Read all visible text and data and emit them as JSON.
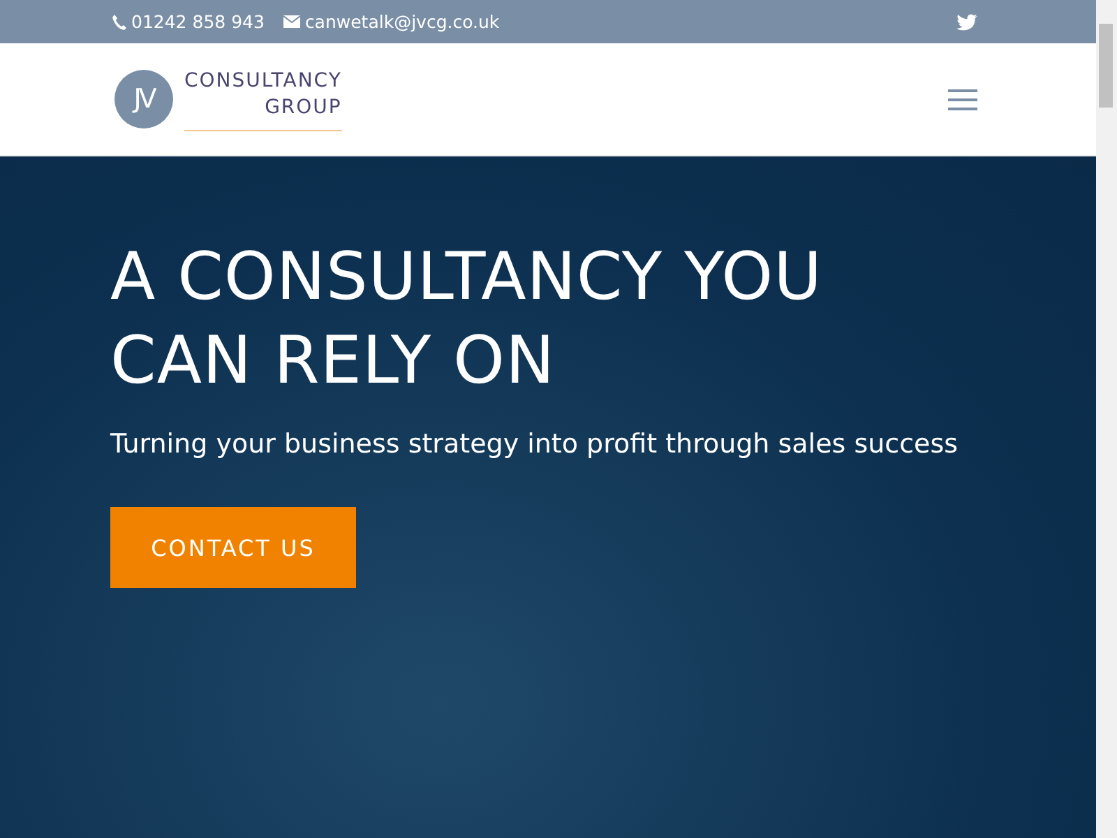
{
  "top_bar": {
    "phone": "01242 858 943",
    "email": "canwetalk@jvcg.co.uk"
  },
  "header": {
    "logo": {
      "monogram": "JV",
      "line_1": "CONSULTANCY",
      "line_2": "GROUP"
    }
  },
  "hero": {
    "title": "A CONSULTANCY YOU CAN RELY ON",
    "subtitle": "Turning your business strategy into profit through sales success",
    "button": "CONTACT US"
  }
}
